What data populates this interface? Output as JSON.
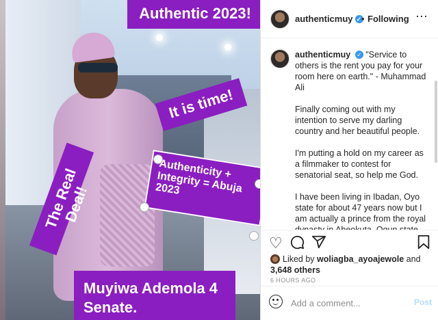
{
  "photo": {
    "labels": {
      "authentic": "Authentic 2023!",
      "time": "It is time!",
      "real_deal": "The Real Deal!",
      "integrity": "Authenticity + Integrity = Abuja 2023",
      "senate": "Muyiwa Ademola 4 Senate."
    },
    "accent_color": "#8a1ec0"
  },
  "header": {
    "username": "authenticmuy",
    "separator": "•",
    "follow_status": "Following",
    "verified_icon": "verified-badge-icon",
    "more_icon": "more-options-icon"
  },
  "caption": {
    "username": "authenticmuy",
    "paragraphs": [
      "\"Service to others is the rent you pay for your room here on earth.\" - Muhammad Ali",
      "Finally coming out with my intention to serve my darling country and her beautiful people.",
      "I'm putting a hold on my career as a filmmaker to contest for senatorial seat, so help me God.",
      "I have been living in Ibadan, Oyo state for about 47 years now but I am actually a prince from the royal dynasty in Abeokuta, Ogun state. Where do you suggest/advice I contest from? Ibadan or Abeokuta?"
    ]
  },
  "actions": {
    "icons": [
      "heart-icon",
      "comment-icon",
      "share-icon",
      "bookmark-icon"
    ],
    "liked_prefix": "Liked by",
    "liked_user": "woliagba_ayoajewole",
    "liked_and": "and",
    "liked_others": "3,648 others",
    "time_ago": "6 HOURS AGO"
  },
  "comment": {
    "placeholder": "Add a comment...",
    "post_label": "Post"
  }
}
